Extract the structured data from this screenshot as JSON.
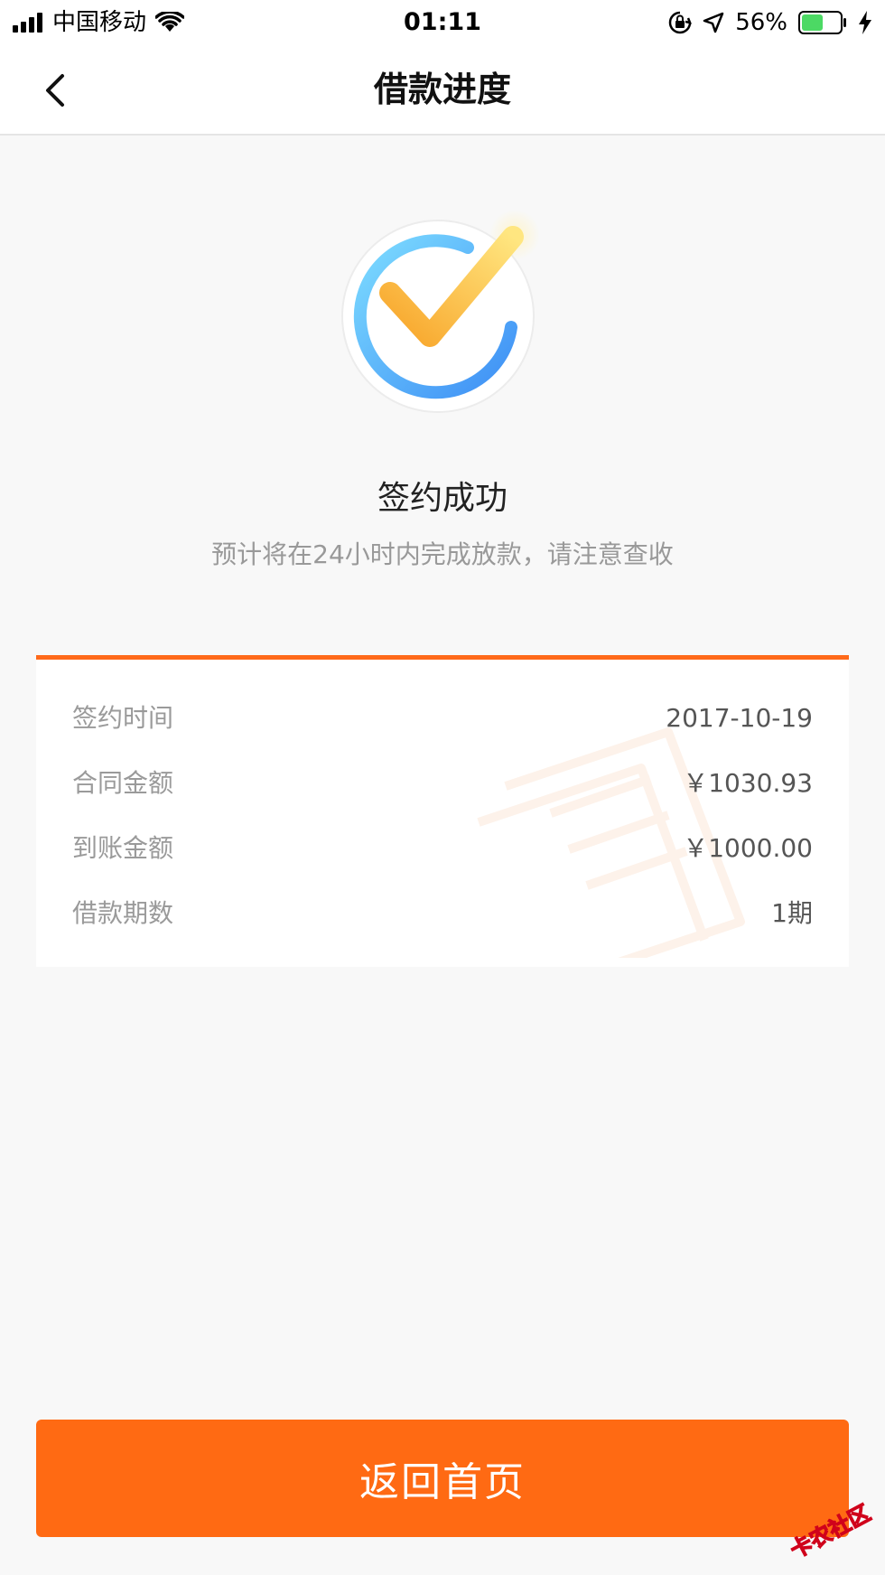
{
  "status_bar": {
    "carrier": "中国移动",
    "time": "01:11",
    "battery": "56%",
    "battery_level": 0.56,
    "icons": [
      "signal-icon",
      "wifi-icon",
      "orientation-lock-icon",
      "location-arrow-icon",
      "battery-icon",
      "charging-bolt-icon"
    ]
  },
  "nav": {
    "title": "借款进度",
    "back_icon": "chevron-left-icon"
  },
  "status": {
    "icon": "checkmark-circle-icon",
    "title": "签约成功",
    "description": "预计将在24小时内完成放款，请注意查收"
  },
  "details": {
    "rows": [
      {
        "label": "签约时间",
        "value": "2017-10-19"
      },
      {
        "label": "合同金额",
        "value": "￥1030.93"
      },
      {
        "label": "到账金额",
        "value": "￥1000.00"
      },
      {
        "label": "借款期数",
        "value": "1期"
      }
    ]
  },
  "actions": {
    "home_label": "返回首页"
  },
  "watermark": {
    "text": "卡农社区"
  },
  "colors": {
    "accent": "#ff6a13",
    "background": "#f8f8f8",
    "battery_green": "#4cd964"
  }
}
